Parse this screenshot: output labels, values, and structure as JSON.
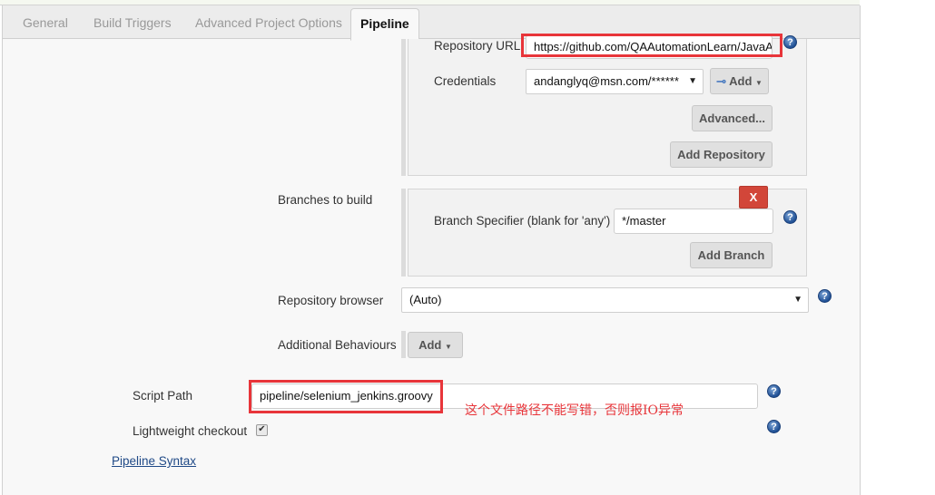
{
  "tabs": [
    {
      "label": "General",
      "active": false
    },
    {
      "label": "Build Triggers",
      "active": false
    },
    {
      "label": "Advanced Project Options",
      "active": false
    },
    {
      "label": "Pipeline",
      "active": true
    }
  ],
  "repository": {
    "url_label": "Repository URL",
    "url_value": "https://github.com/QAAutomationLearn/JavaA",
    "credentials_label": "Credentials",
    "credentials_value": "andanglyq@msn.com/******",
    "add_credentials_label": "Add",
    "advanced_label": "Advanced...",
    "add_repository_label": "Add Repository"
  },
  "branches": {
    "section_label": "Branches to build",
    "delete_label": "X",
    "specifier_label": "Branch Specifier (blank for 'any')",
    "specifier_value": "*/master",
    "add_branch_label": "Add Branch"
  },
  "repository_browser": {
    "label": "Repository browser",
    "value": "(Auto)"
  },
  "additional_behaviours": {
    "label": "Additional Behaviours",
    "add_label": "Add"
  },
  "script_path": {
    "label": "Script Path",
    "value": "pipeline/selenium_jenkins.groovy",
    "annotation": "这个文件路径不能写错，否则报IO异常"
  },
  "lightweight_checkout": {
    "label": "Lightweight checkout",
    "checked": true
  },
  "pipeline_syntax_link": "Pipeline Syntax",
  "icons": {
    "help": "help-icon",
    "key": "key-icon",
    "dropdown": "chevron-down-icon",
    "check": "checkmark-icon"
  },
  "colors": {
    "annotation_red": "#e8353a",
    "delete_button": "#d24639",
    "link": "#204a87",
    "panel_bg": "#f8f8f8"
  }
}
